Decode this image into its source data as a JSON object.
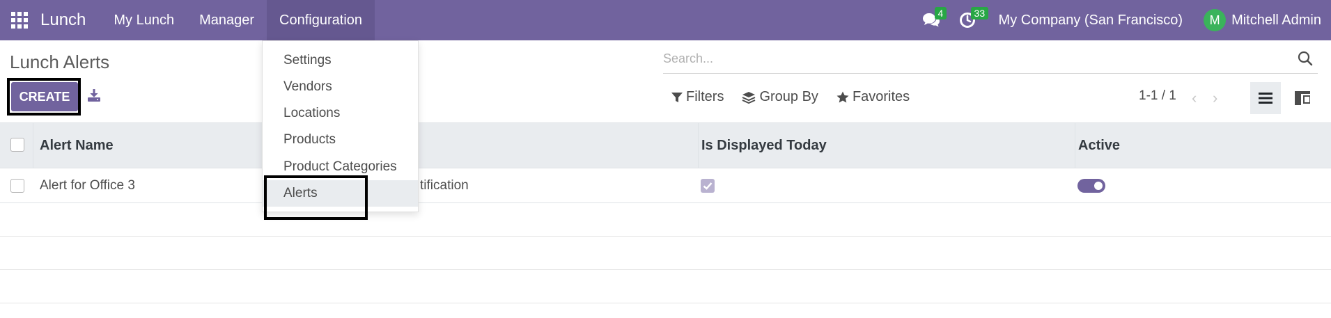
{
  "navbar": {
    "brand": "Lunch",
    "menus": [
      "My Lunch",
      "Manager",
      "Configuration"
    ],
    "messages_badge": "4",
    "activities_badge": "33",
    "company": "My Company (San Francisco)",
    "avatar_letter": "M",
    "user": "Mitchell Admin"
  },
  "control_panel": {
    "title": "Lunch Alerts",
    "create_label": "CREATE",
    "search_placeholder": "Search...",
    "filters_label": "Filters",
    "groupby_label": "Group By",
    "favorites_label": "Favorites",
    "pager": "1-1 / 1"
  },
  "dropdown": {
    "items": [
      "Settings",
      "Vendors",
      "Locations",
      "Products",
      "Product Categories",
      "Alerts"
    ]
  },
  "table": {
    "headers": {
      "name": "Alert Name",
      "displayed": "Is Displayed Today",
      "active": "Active"
    },
    "rows": [
      {
        "name": "Alert for Office 3",
        "mode": "tification",
        "displayed_today": true,
        "active": true
      }
    ]
  },
  "colors": {
    "primary": "#71639e",
    "badge": "#28a745",
    "avatar": "#3ab35b"
  }
}
